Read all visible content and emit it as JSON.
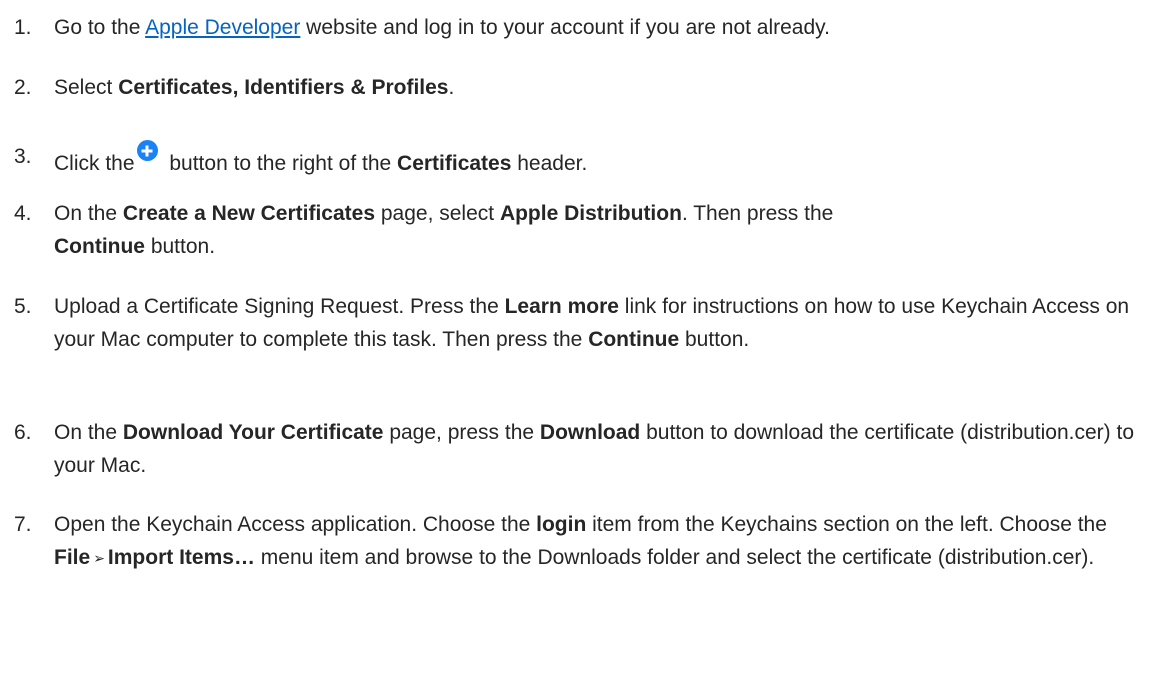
{
  "steps": [
    {
      "num": "1.",
      "pre": "Go to the ",
      "link": "Apple Developer",
      "post": " website and log in to your account if you are not already."
    },
    {
      "num": "2.",
      "pre": "Select ",
      "b1": "Certificates, Identifiers & Profiles",
      "post": "."
    },
    {
      "num": "3.",
      "pre": "Click the",
      "mid": " button to the right of the ",
      "b1": "Certificates",
      "post": " header."
    },
    {
      "num": "4.",
      "pre": "On the ",
      "b1": "Create a New Certificates",
      "mid": " page, select ",
      "b2": "Apple Distribution",
      "mid2": ". Then press the",
      "b3": "Continue",
      "post": " button."
    },
    {
      "num": "5.",
      "pre": "Upload a Certificate Signing Request. Press the ",
      "b1": "Learn more",
      "mid": " link for instructions on how to use Keychain Access on your Mac computer to complete this task. Then press the ",
      "b2": "Continue",
      "post": " button."
    },
    {
      "num": "6.",
      "pre": "On the ",
      "b1": "Download Your Certificate",
      "mid": " page, press the ",
      "b2": "Download",
      "post": " button to download the certificate (distribution.cer) to your Mac."
    },
    {
      "num": "7.",
      "pre": "Open the Keychain Access application. Choose the ",
      "b1": "login",
      "mid": " item from the Keychains section on the left. Choose the ",
      "b2": "File",
      "arrow": "➢",
      "b3": "Import Items…",
      "post": " menu item and browse to the Downloads folder and select the certificate (distribution.cer)."
    }
  ]
}
